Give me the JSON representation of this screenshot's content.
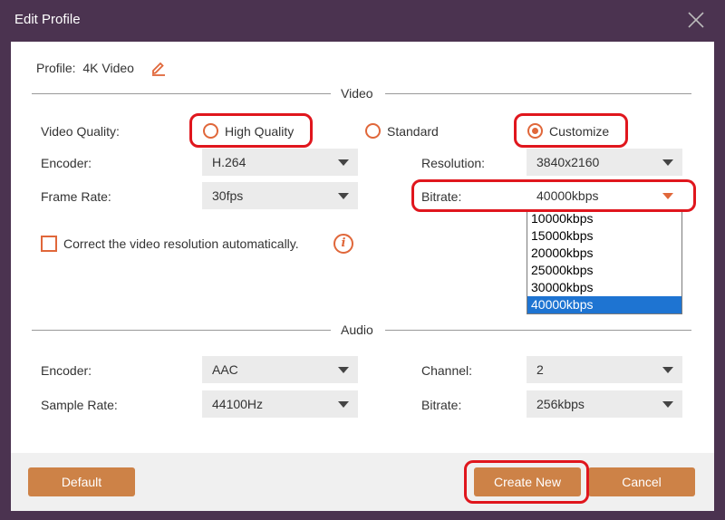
{
  "window": {
    "title": "Edit Profile"
  },
  "profile": {
    "label": "Profile:",
    "name": "4K Video"
  },
  "video": {
    "section_label": "Video",
    "quality_label": "Video Quality:",
    "quality_options": [
      "High Quality",
      "Standard",
      "Customize"
    ],
    "quality_selected": "Customize",
    "encoder_label": "Encoder:",
    "encoder_value": "H.264",
    "framerate_label": "Frame Rate:",
    "framerate_value": "30fps",
    "resolution_label": "Resolution:",
    "resolution_value": "3840x2160",
    "bitrate_label": "Bitrate:",
    "bitrate_value": "40000kbps",
    "bitrate_options": [
      "10000kbps",
      "15000kbps",
      "20000kbps",
      "25000kbps",
      "30000kbps",
      "40000kbps"
    ],
    "correct_resolution_label": "Correct the video resolution automatically."
  },
  "audio": {
    "section_label": "Audio",
    "encoder_label": "Encoder:",
    "encoder_value": "AAC",
    "samplerate_label": "Sample Rate:",
    "samplerate_value": "44100Hz",
    "channel_label": "Channel:",
    "channel_value": "2",
    "bitrate_label": "Bitrate:",
    "bitrate_value": "256kbps"
  },
  "buttons": {
    "default": "Default",
    "create_new": "Create New",
    "cancel": "Cancel"
  },
  "colors": {
    "titlebar": "#4b3350",
    "accent": "#e0673a",
    "button": "#cd8247",
    "highlight": "#e0161d",
    "selection": "#1e74d2"
  }
}
